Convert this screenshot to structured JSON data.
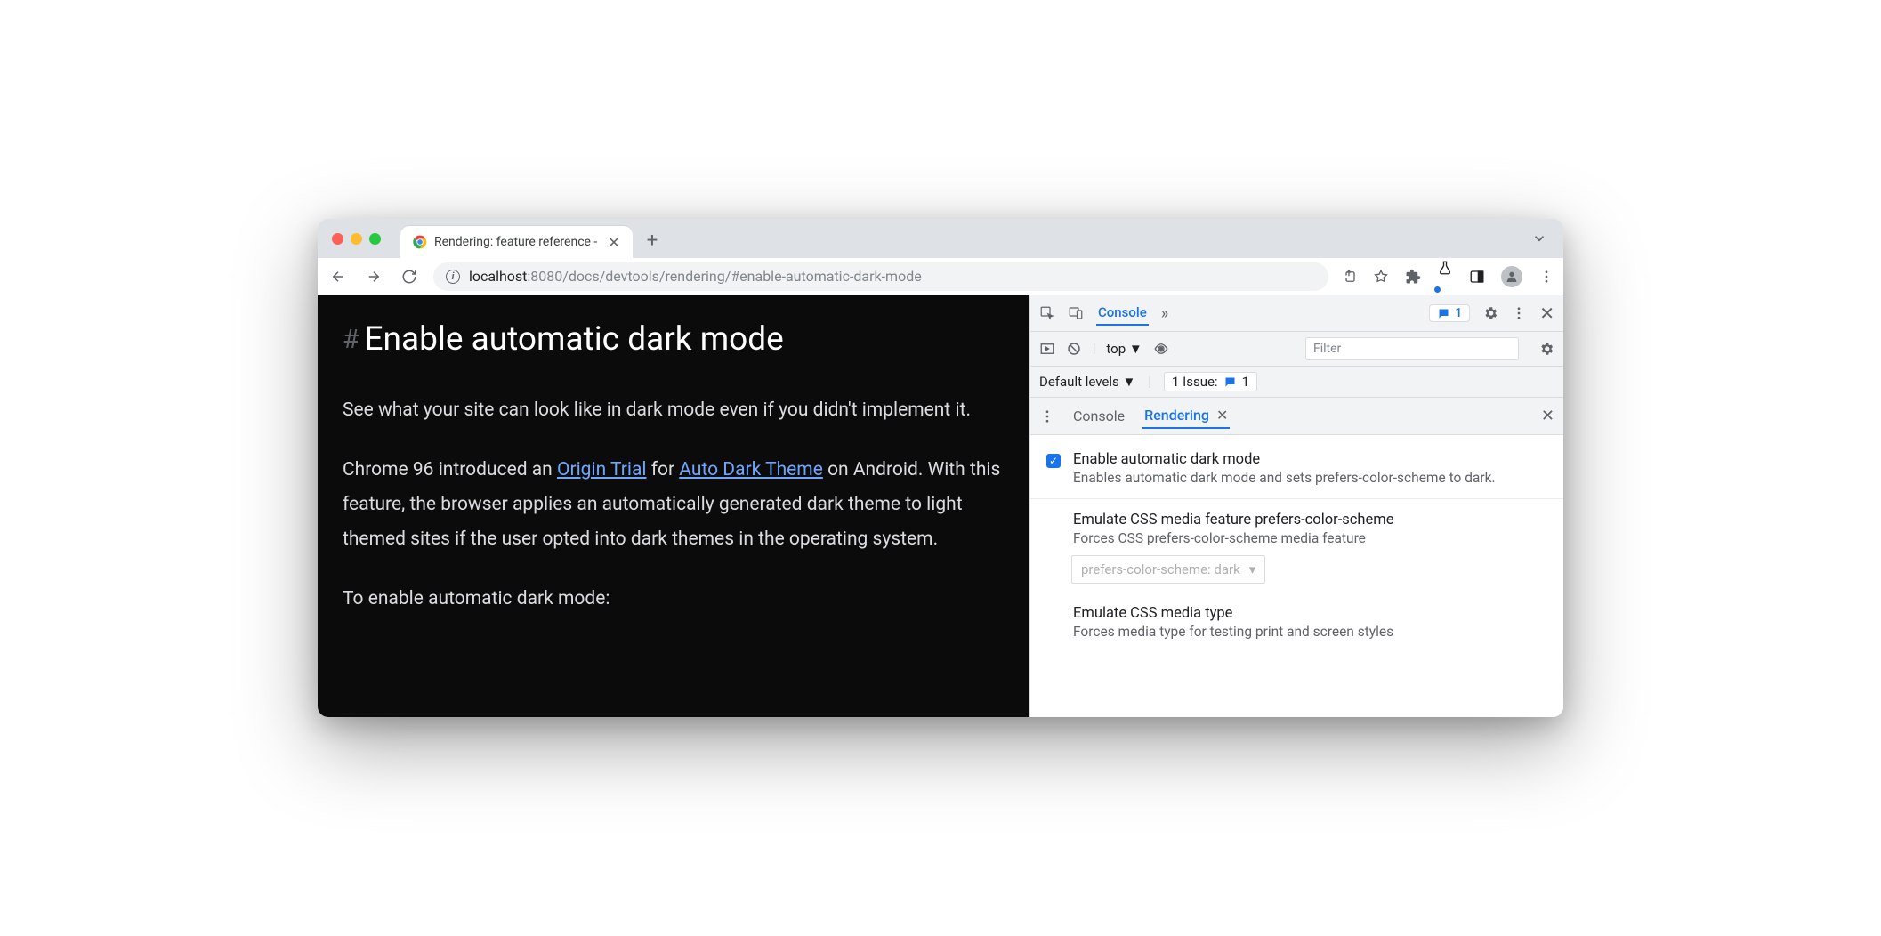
{
  "browser": {
    "tab_title": "Rendering: feature reference -",
    "new_tab": "+",
    "url_dim1": "localhost",
    "url_dim2": ":8080",
    "url_rest": "/docs/devtools/rendering/#enable-automatic-dark-mode"
  },
  "page": {
    "heading": "Enable automatic dark mode",
    "p1": "See what your site can look like in dark mode even if you didn't implement it.",
    "p2a": "Chrome 96 introduced an ",
    "link1": "Origin Trial",
    "p2b": " for ",
    "link2": "Auto Dark Theme",
    "p2c": " on Android. With this feature, the browser applies an automatically generated dark theme to light themed sites if the user opted into dark themes in the operating system.",
    "p3": "To enable automatic dark mode:"
  },
  "devtools": {
    "tab_console": "Console",
    "issues_count": "1",
    "context": "top",
    "filter_placeholder": "Filter",
    "levels": "Default levels",
    "issue_text": "1 Issue:",
    "issue_badge": "1",
    "drawer_console": "Console",
    "drawer_rendering": "Rendering",
    "r1_title": "Enable automatic dark mode",
    "r1_desc": "Enables automatic dark mode and sets prefers-color-scheme to dark.",
    "r2_title": "Emulate CSS media feature prefers-color-scheme",
    "r2_desc": "Forces CSS prefers-color-scheme media feature",
    "r2_select": "prefers-color-scheme: dark",
    "r3_title": "Emulate CSS media type",
    "r3_desc": "Forces media type for testing print and screen styles"
  }
}
